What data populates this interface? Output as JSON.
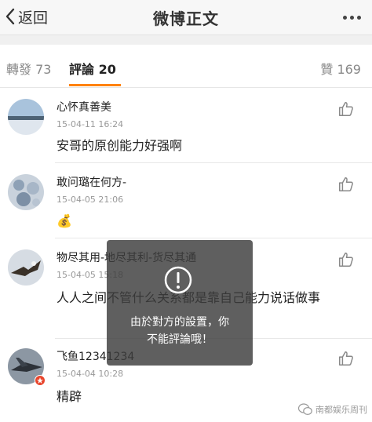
{
  "nav": {
    "back_label": "返回",
    "title": "微博正文"
  },
  "tabs": {
    "repost": "轉發 73",
    "comments": "評論 20",
    "likes": "贊 169"
  },
  "comments": [
    {
      "name": "心怀真善美",
      "time": "15-04-11 16:24",
      "text": "安哥的原创能力好强啊"
    },
    {
      "name": "敢问璐在何方-",
      "time": "15-04-05 21:06",
      "text": "💰"
    },
    {
      "name": "物尽其用-地尽其利-货尽其通",
      "time": "15-04-05 15:18",
      "text": "人人之间不管什么关系都是靠自己能力说话做事"
    },
    {
      "name": "飞鱼12341234",
      "time": "15-04-04 10:28",
      "text": "精辟"
    }
  ],
  "toast": {
    "line1": "由於對方的設置，你",
    "line2": "不能評論哦！"
  },
  "watermark": "南都娱乐周刊"
}
